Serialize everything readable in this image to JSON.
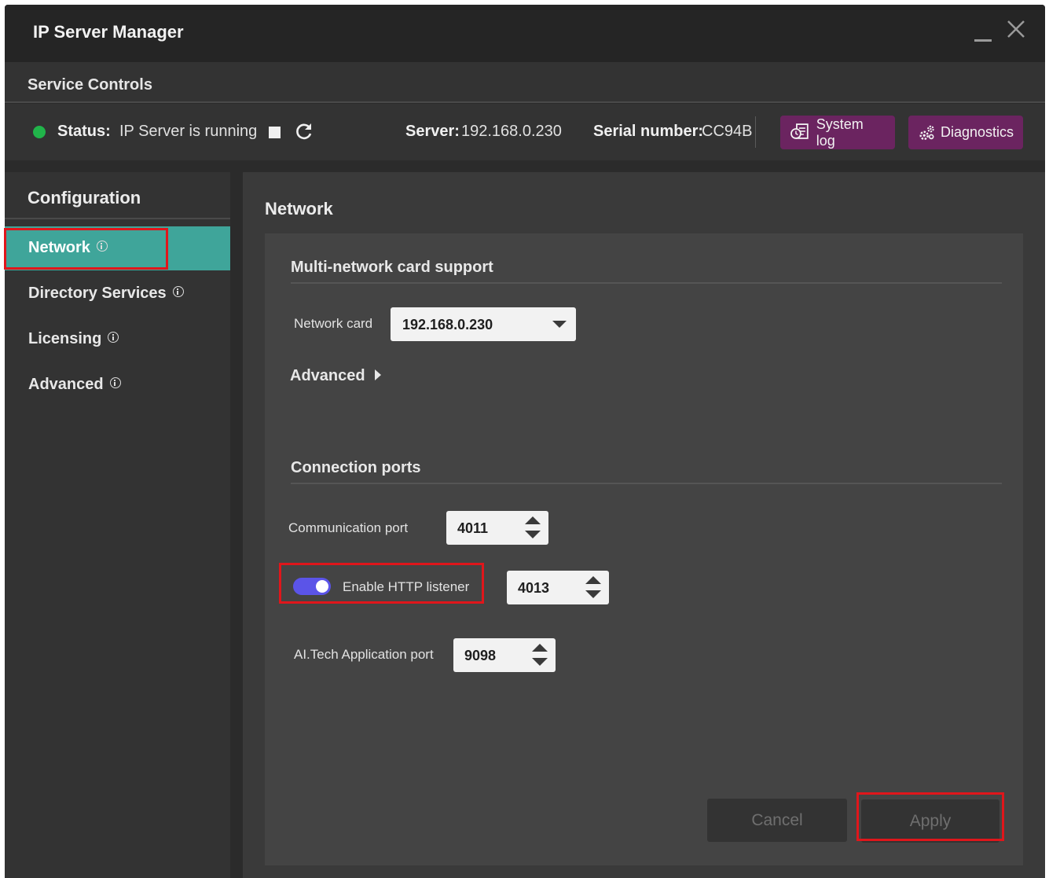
{
  "window": {
    "title": "IP Server Manager"
  },
  "service_controls": {
    "title": "Service Controls",
    "status_label": "Status:",
    "status_value": "IP Server is running",
    "server_label": "Server:",
    "server_value": "192.168.0.230",
    "serial_label": "Serial number:",
    "serial_value": "CC94B",
    "status_color": "#21b44a",
    "system_log_label": "System log",
    "diagnostics_label": "Diagnostics"
  },
  "sidebar": {
    "title": "Configuration",
    "items": [
      {
        "label": "Network",
        "active": true
      },
      {
        "label": "Directory Services",
        "active": false
      },
      {
        "label": "Licensing",
        "active": false
      },
      {
        "label": "Advanced",
        "active": false
      }
    ]
  },
  "main": {
    "title": "Network",
    "multi_network": {
      "title": "Multi-network card support",
      "network_card_label": "Network card",
      "network_card_value": "192.168.0.230",
      "advanced_label": "Advanced"
    },
    "ports": {
      "title": "Connection ports",
      "communication_label": "Communication port",
      "communication_value": "4011",
      "http_label": "Enable HTTP listener",
      "http_enabled": true,
      "http_value": "4013",
      "ai_label": "AI.Tech Application port",
      "ai_value": "9098"
    },
    "cancel_label": "Cancel",
    "apply_label": "Apply"
  },
  "colors": {
    "accent_teal": "#3fa59a",
    "button_purple": "#6b2460",
    "toggle_blue": "#5b54e8",
    "highlight_red": "#e0161b"
  }
}
